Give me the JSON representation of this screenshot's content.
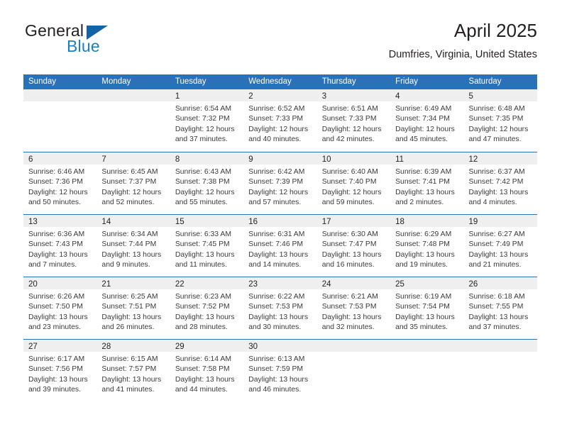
{
  "brand": {
    "name_part1": "General",
    "name_part2": "Blue",
    "triangle_color": "#1464a5",
    "blue_text_color": "#1b7fc4"
  },
  "header": {
    "title": "April 2025",
    "subtitle": "Dumfries, Virginia, United States"
  },
  "theme": {
    "header_bar_color": "#2a71b8",
    "day_band_color": "#efefef",
    "row_divider_color": "#2a71b8",
    "text_color": "#231f20"
  },
  "weekdays": [
    "Sunday",
    "Monday",
    "Tuesday",
    "Wednesday",
    "Thursday",
    "Friday",
    "Saturday"
  ],
  "weeks": [
    [
      {
        "day": "",
        "lines": []
      },
      {
        "day": "",
        "lines": []
      },
      {
        "day": "1",
        "lines": [
          "Sunrise: 6:54 AM",
          "Sunset: 7:32 PM",
          "Daylight: 12 hours",
          "and 37 minutes."
        ]
      },
      {
        "day": "2",
        "lines": [
          "Sunrise: 6:52 AM",
          "Sunset: 7:33 PM",
          "Daylight: 12 hours",
          "and 40 minutes."
        ]
      },
      {
        "day": "3",
        "lines": [
          "Sunrise: 6:51 AM",
          "Sunset: 7:33 PM",
          "Daylight: 12 hours",
          "and 42 minutes."
        ]
      },
      {
        "day": "4",
        "lines": [
          "Sunrise: 6:49 AM",
          "Sunset: 7:34 PM",
          "Daylight: 12 hours",
          "and 45 minutes."
        ]
      },
      {
        "day": "5",
        "lines": [
          "Sunrise: 6:48 AM",
          "Sunset: 7:35 PM",
          "Daylight: 12 hours",
          "and 47 minutes."
        ]
      }
    ],
    [
      {
        "day": "6",
        "lines": [
          "Sunrise: 6:46 AM",
          "Sunset: 7:36 PM",
          "Daylight: 12 hours",
          "and 50 minutes."
        ]
      },
      {
        "day": "7",
        "lines": [
          "Sunrise: 6:45 AM",
          "Sunset: 7:37 PM",
          "Daylight: 12 hours",
          "and 52 minutes."
        ]
      },
      {
        "day": "8",
        "lines": [
          "Sunrise: 6:43 AM",
          "Sunset: 7:38 PM",
          "Daylight: 12 hours",
          "and 55 minutes."
        ]
      },
      {
        "day": "9",
        "lines": [
          "Sunrise: 6:42 AM",
          "Sunset: 7:39 PM",
          "Daylight: 12 hours",
          "and 57 minutes."
        ]
      },
      {
        "day": "10",
        "lines": [
          "Sunrise: 6:40 AM",
          "Sunset: 7:40 PM",
          "Daylight: 12 hours",
          "and 59 minutes."
        ]
      },
      {
        "day": "11",
        "lines": [
          "Sunrise: 6:39 AM",
          "Sunset: 7:41 PM",
          "Daylight: 13 hours",
          "and 2 minutes."
        ]
      },
      {
        "day": "12",
        "lines": [
          "Sunrise: 6:37 AM",
          "Sunset: 7:42 PM",
          "Daylight: 13 hours",
          "and 4 minutes."
        ]
      }
    ],
    [
      {
        "day": "13",
        "lines": [
          "Sunrise: 6:36 AM",
          "Sunset: 7:43 PM",
          "Daylight: 13 hours",
          "and 7 minutes."
        ]
      },
      {
        "day": "14",
        "lines": [
          "Sunrise: 6:34 AM",
          "Sunset: 7:44 PM",
          "Daylight: 13 hours",
          "and 9 minutes."
        ]
      },
      {
        "day": "15",
        "lines": [
          "Sunrise: 6:33 AM",
          "Sunset: 7:45 PM",
          "Daylight: 13 hours",
          "and 11 minutes."
        ]
      },
      {
        "day": "16",
        "lines": [
          "Sunrise: 6:31 AM",
          "Sunset: 7:46 PM",
          "Daylight: 13 hours",
          "and 14 minutes."
        ]
      },
      {
        "day": "17",
        "lines": [
          "Sunrise: 6:30 AM",
          "Sunset: 7:47 PM",
          "Daylight: 13 hours",
          "and 16 minutes."
        ]
      },
      {
        "day": "18",
        "lines": [
          "Sunrise: 6:29 AM",
          "Sunset: 7:48 PM",
          "Daylight: 13 hours",
          "and 19 minutes."
        ]
      },
      {
        "day": "19",
        "lines": [
          "Sunrise: 6:27 AM",
          "Sunset: 7:49 PM",
          "Daylight: 13 hours",
          "and 21 minutes."
        ]
      }
    ],
    [
      {
        "day": "20",
        "lines": [
          "Sunrise: 6:26 AM",
          "Sunset: 7:50 PM",
          "Daylight: 13 hours",
          "and 23 minutes."
        ]
      },
      {
        "day": "21",
        "lines": [
          "Sunrise: 6:25 AM",
          "Sunset: 7:51 PM",
          "Daylight: 13 hours",
          "and 26 minutes."
        ]
      },
      {
        "day": "22",
        "lines": [
          "Sunrise: 6:23 AM",
          "Sunset: 7:52 PM",
          "Daylight: 13 hours",
          "and 28 minutes."
        ]
      },
      {
        "day": "23",
        "lines": [
          "Sunrise: 6:22 AM",
          "Sunset: 7:53 PM",
          "Daylight: 13 hours",
          "and 30 minutes."
        ]
      },
      {
        "day": "24",
        "lines": [
          "Sunrise: 6:21 AM",
          "Sunset: 7:53 PM",
          "Daylight: 13 hours",
          "and 32 minutes."
        ]
      },
      {
        "day": "25",
        "lines": [
          "Sunrise: 6:19 AM",
          "Sunset: 7:54 PM",
          "Daylight: 13 hours",
          "and 35 minutes."
        ]
      },
      {
        "day": "26",
        "lines": [
          "Sunrise: 6:18 AM",
          "Sunset: 7:55 PM",
          "Daylight: 13 hours",
          "and 37 minutes."
        ]
      }
    ],
    [
      {
        "day": "27",
        "lines": [
          "Sunrise: 6:17 AM",
          "Sunset: 7:56 PM",
          "Daylight: 13 hours",
          "and 39 minutes."
        ]
      },
      {
        "day": "28",
        "lines": [
          "Sunrise: 6:15 AM",
          "Sunset: 7:57 PM",
          "Daylight: 13 hours",
          "and 41 minutes."
        ]
      },
      {
        "day": "29",
        "lines": [
          "Sunrise: 6:14 AM",
          "Sunset: 7:58 PM",
          "Daylight: 13 hours",
          "and 44 minutes."
        ]
      },
      {
        "day": "30",
        "lines": [
          "Sunrise: 6:13 AM",
          "Sunset: 7:59 PM",
          "Daylight: 13 hours",
          "and 46 minutes."
        ]
      },
      {
        "day": "",
        "lines": []
      },
      {
        "day": "",
        "lines": []
      },
      {
        "day": "",
        "lines": []
      }
    ]
  ]
}
